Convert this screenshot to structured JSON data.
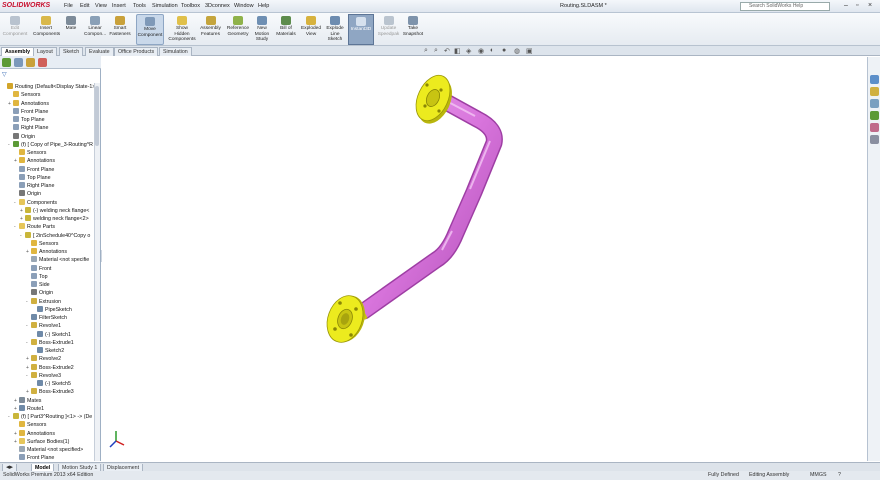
{
  "app": {
    "logo": "SOLIDWORKS",
    "title": "Routing.SLDASM *"
  },
  "menus": [
    "File",
    "Edit",
    "View",
    "Insert",
    "Tools",
    "Simulation",
    "Toolbox",
    "3Dconnex",
    "Window",
    "Help"
  ],
  "help_search": {
    "placeholder": "Search SolidWorks Help"
  },
  "ribbon": [
    {
      "label": "Edit\nComponent",
      "state": "disabled",
      "color": "#b9c3cf"
    },
    {
      "label": "Insert\nComponents",
      "state": "normal",
      "color": "#d9b84a"
    },
    {
      "label": "Mate",
      "state": "normal",
      "color": "#7d8b99"
    },
    {
      "label": "Linear\nCompon...",
      "state": "normal",
      "color": "#8aa0b7"
    },
    {
      "label": "Smart\nFasteners",
      "state": "normal",
      "color": "#c9a13a"
    },
    {
      "label": "Move\nComponent",
      "state": "pressed",
      "color": "#7f99b8"
    },
    {
      "label": "Show\nHidden\nComponents",
      "state": "normal",
      "color": "#e0c04a"
    },
    {
      "label": "Assembly\nFeatures",
      "state": "normal",
      "color": "#c5a53d"
    },
    {
      "label": "Reference\nGeometry",
      "state": "normal",
      "color": "#8fb24a"
    },
    {
      "label": "New\nMotion\nStudy",
      "state": "normal",
      "color": "#6e8fb3"
    },
    {
      "label": "Bill of\nMaterials",
      "state": "normal",
      "color": "#5d8c4c"
    },
    {
      "label": "Exploded\nView",
      "state": "normal",
      "color": "#d7b23e"
    },
    {
      "label": "Explode\nLine\nSketch",
      "state": "normal",
      "color": "#6d8cb0"
    },
    {
      "label": "Instant3D",
      "state": "active",
      "color": "#d6e1ee"
    },
    {
      "label": "Update\nSpeedpak",
      "state": "disabled",
      "color": "#bac4cf"
    },
    {
      "label": "Take\nSnapshot",
      "state": "normal",
      "color": "#7e93ab"
    }
  ],
  "tabs": [
    {
      "label": "Assembly",
      "selected": true
    },
    {
      "label": "Layout",
      "selected": false
    },
    {
      "label": "Sketch",
      "selected": false
    },
    {
      "label": "Evaluate",
      "selected": false
    },
    {
      "label": "Office Products",
      "selected": false
    },
    {
      "label": "Simulation",
      "selected": false
    }
  ],
  "tree": [
    {
      "label": "Routing  (Default<Display State-1>",
      "indent": 0,
      "icon": "assembly-icon",
      "color": "#d2a52a",
      "exp": ""
    },
    {
      "label": "Sensors",
      "indent": 1,
      "icon": "sensors-icon",
      "color": "#e0b640",
      "exp": ""
    },
    {
      "label": "Annotations",
      "indent": 1,
      "icon": "annotations-icon",
      "color": "#e0b640",
      "exp": "+"
    },
    {
      "label": "Front Plane",
      "indent": 1,
      "icon": "plane-icon",
      "color": "#8b9fb8",
      "exp": ""
    },
    {
      "label": "Top Plane",
      "indent": 1,
      "icon": "plane-icon",
      "color": "#8b9fb8",
      "exp": ""
    },
    {
      "label": "Right Plane",
      "indent": 1,
      "icon": "plane-icon",
      "color": "#8b9fb8",
      "exp": ""
    },
    {
      "label": "Origin",
      "indent": 1,
      "icon": "origin-icon",
      "color": "#777",
      "exp": ""
    },
    {
      "label": "(f) [ Copy of Pipe_3-Routing^R",
      "indent": 1,
      "icon": "subassembly-icon",
      "color": "#5c9a36",
      "exp": "-"
    },
    {
      "label": "Sensors",
      "indent": 2,
      "icon": "sensors-icon",
      "color": "#e0b640",
      "exp": ""
    },
    {
      "label": "Annotations",
      "indent": 2,
      "icon": "annotations-icon",
      "color": "#e0b640",
      "exp": "+"
    },
    {
      "label": "Front Plane",
      "indent": 2,
      "icon": "plane-icon",
      "color": "#8b9fb8",
      "exp": ""
    },
    {
      "label": "Top Plane",
      "indent": 2,
      "icon": "plane-icon",
      "color": "#8b9fb8",
      "exp": ""
    },
    {
      "label": "Right Plane",
      "indent": 2,
      "icon": "plane-icon",
      "color": "#8b9fb8",
      "exp": ""
    },
    {
      "label": "Origin",
      "indent": 2,
      "icon": "origin-icon",
      "color": "#777",
      "exp": ""
    },
    {
      "label": "Components",
      "indent": 2,
      "icon": "folder-icon",
      "color": "#e6c65a",
      "exp": "-"
    },
    {
      "label": "(-) welding neck flange<",
      "indent": 3,
      "icon": "part-icon",
      "color": "#c9b63a",
      "exp": "+"
    },
    {
      "label": "welding neck flange<2>",
      "indent": 3,
      "icon": "part-icon",
      "color": "#c9b63a",
      "exp": "+"
    },
    {
      "label": "Route Parts",
      "indent": 2,
      "icon": "folder-icon",
      "color": "#e6c65a",
      "exp": "-"
    },
    {
      "label": "[ 2inSchedule40^Copy o",
      "indent": 3,
      "icon": "part-icon",
      "color": "#c9b63a",
      "exp": "-"
    },
    {
      "label": "Sensors",
      "indent": 4,
      "icon": "sensors-icon",
      "color": "#e0b640",
      "exp": ""
    },
    {
      "label": "Annotations",
      "indent": 4,
      "icon": "annotations-icon",
      "color": "#e0b640",
      "exp": "+"
    },
    {
      "label": "Material <not specifie",
      "indent": 4,
      "icon": "material-icon",
      "color": "#9aa7b4",
      "exp": ""
    },
    {
      "label": "Front",
      "indent": 4,
      "icon": "plane-icon",
      "color": "#8b9fb8",
      "exp": ""
    },
    {
      "label": "Top",
      "indent": 4,
      "icon": "plane-icon",
      "color": "#8b9fb8",
      "exp": ""
    },
    {
      "label": "Side",
      "indent": 4,
      "icon": "plane-icon",
      "color": "#8b9fb8",
      "exp": ""
    },
    {
      "label": "Origin",
      "indent": 4,
      "icon": "origin-icon",
      "color": "#777",
      "exp": ""
    },
    {
      "label": "Extrusion",
      "indent": 4,
      "icon": "extrude-icon",
      "color": "#d0b040",
      "exp": "-"
    },
    {
      "label": "PipeSketch",
      "indent": 5,
      "icon": "sketch-icon",
      "color": "#6f8aa8",
      "exp": ""
    },
    {
      "label": "FilterSketch",
      "indent": 4,
      "icon": "sketch-icon",
      "color": "#6f8aa8",
      "exp": ""
    },
    {
      "label": "Revolve1",
      "indent": 4,
      "icon": "revolve-icon",
      "color": "#d0b040",
      "exp": "-"
    },
    {
      "label": "(-) Sketch1",
      "indent": 5,
      "icon": "sketch-icon",
      "color": "#6f8aa8",
      "exp": ""
    },
    {
      "label": "Boss-Extrude1",
      "indent": 4,
      "icon": "extrude-icon",
      "color": "#d0b040",
      "exp": "-"
    },
    {
      "label": "Sketch2",
      "indent": 5,
      "icon": "sketch-icon",
      "color": "#6f8aa8",
      "exp": ""
    },
    {
      "label": "Revolve2",
      "indent": 4,
      "icon": "revolve-icon",
      "color": "#d0b040",
      "exp": "+"
    },
    {
      "label": "Boss-Extrude2",
      "indent": 4,
      "icon": "extrude-icon",
      "color": "#d0b040",
      "exp": "+"
    },
    {
      "label": "Revolve3",
      "indent": 4,
      "icon": "revolve-icon",
      "color": "#d0b040",
      "exp": "-"
    },
    {
      "label": "(-) Sketch5",
      "indent": 5,
      "icon": "sketch-icon",
      "color": "#6f8aa8",
      "exp": ""
    },
    {
      "label": "Boss-Extrude3",
      "indent": 4,
      "icon": "extrude-icon",
      "color": "#d0b040",
      "exp": "+"
    },
    {
      "label": "Mates",
      "indent": 2,
      "icon": "mates-icon",
      "color": "#7d8b99",
      "exp": "+"
    },
    {
      "label": "Route1",
      "indent": 2,
      "icon": "route-icon",
      "color": "#6f8aa8",
      "exp": "+"
    },
    {
      "label": "(f) [ Part3^Routing ]<1> -> (De",
      "indent": 1,
      "icon": "part-icon",
      "color": "#c9b63a",
      "exp": "-"
    },
    {
      "label": "Sensors",
      "indent": 2,
      "icon": "sensors-icon",
      "color": "#e0b640",
      "exp": ""
    },
    {
      "label": "Annotations",
      "indent": 2,
      "icon": "annotations-icon",
      "color": "#e0b640",
      "exp": "+"
    },
    {
      "label": "Surface Bodies(1)",
      "indent": 2,
      "icon": "folder-icon",
      "color": "#e6c65a",
      "exp": "+"
    },
    {
      "label": "Material <not specified>",
      "indent": 2,
      "icon": "material-icon",
      "color": "#9aa7b4",
      "exp": ""
    },
    {
      "label": "Front Plane",
      "indent": 2,
      "icon": "plane-icon",
      "color": "#8b9fb8",
      "exp": ""
    }
  ],
  "bottom_tabs": [
    {
      "label": "Model",
      "selected": true
    },
    {
      "label": "Motion Study 1",
      "selected": false
    },
    {
      "label": "Displacement",
      "selected": false
    }
  ],
  "status": {
    "left": "SolidWorks Premium 2013 x64 Edition",
    "defined": "Fully Defined",
    "mode": "Editing Assembly",
    "units": "MMGS"
  },
  "colors": {
    "pipe": "#d874dc",
    "flange": "#e8e81a",
    "accent": "#c8102e"
  }
}
